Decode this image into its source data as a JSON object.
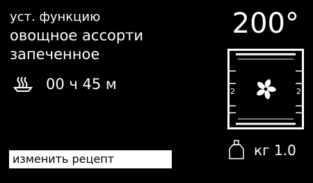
{
  "function_label": "уст. функцию",
  "recipe": {
    "line1": "овощное ассорти",
    "line2": "запеченное"
  },
  "temperature": "200°",
  "cook_time": {
    "icon": "dish-icon",
    "value": "00 ч 45 м"
  },
  "oven": {
    "icon": "fan-icon",
    "left_level": "2",
    "right_level": "2"
  },
  "edit_button_label": "изменить рецепт",
  "weight": {
    "icon": "weight-icon",
    "value": "кг 1.0"
  },
  "colors": {
    "background": "#000000",
    "foreground": "#ffffff"
  }
}
